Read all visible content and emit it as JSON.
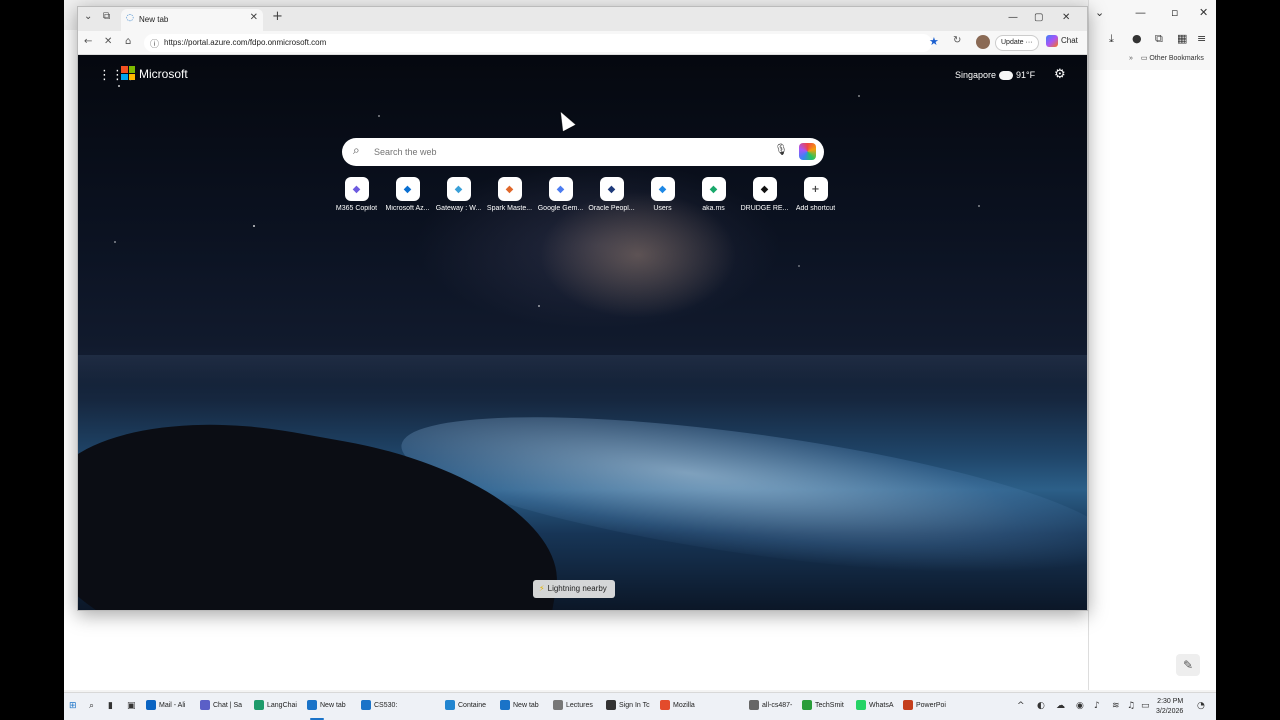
{
  "browser": {
    "tab_title": "New tab",
    "url": "https://portal.azure.com/fdpo.onmicrosoft.com",
    "update_label": "Update",
    "chat_label": "Chat"
  },
  "background_browser": {
    "bookmarks_label": "Other Bookmarks"
  },
  "new_tab_page": {
    "brand": "Microsoft",
    "weather_city": "Singapore",
    "weather_temp": "91°F",
    "search_placeholder": "Search the web",
    "shortcuts": [
      {
        "label": "M365 Copilot",
        "icon": "copilot-icon",
        "color": "#6d5be0"
      },
      {
        "label": "Microsoft Az...",
        "icon": "azure-icon",
        "color": "#0a6fd1"
      },
      {
        "label": "Gateway : W...",
        "icon": "gateway-icon",
        "color": "#3aa0d8"
      },
      {
        "label": "Spark Maste...",
        "icon": "spark-icon",
        "color": "#e0672a"
      },
      {
        "label": "Google Gem...",
        "icon": "gemini-icon",
        "color": "#4c7cf0"
      },
      {
        "label": "Oracle Peopl...",
        "icon": "oracle-icon",
        "color": "#1e3a7a"
      },
      {
        "label": "Users",
        "icon": "users-icon",
        "color": "#1e88e5"
      },
      {
        "label": "aka.ms",
        "icon": "akams-icon",
        "color": "#19a86b"
      },
      {
        "label": "DRUDGE RE...",
        "icon": "drudge-icon",
        "color": "#111111"
      },
      {
        "label": "Add shortcut",
        "icon": "plus-icon",
        "color": "#444444"
      }
    ],
    "notification": "Lightning nearby"
  },
  "taskbar": {
    "items": [
      {
        "label": "Mail - Ali",
        "color": "#0a64c2"
      },
      {
        "label": "Chat | Sa",
        "color": "#5b5fc7"
      },
      {
        "label": "LangChai",
        "color": "#1e9b6b"
      },
      {
        "label": "New tab",
        "color": "#1a73c8"
      },
      {
        "label": "CS530:",
        "color": "#1a73c8"
      },
      {
        "label": "Containe",
        "color": "#2185d0"
      },
      {
        "label": "New tab",
        "color": "#1a73c8"
      },
      {
        "label": "Lectures",
        "color": "#777777"
      },
      {
        "label": "Sign In Tc",
        "color": "#333333"
      },
      {
        "label": "Mozilla",
        "color": "#e34b2b"
      },
      {
        "label": "all-cs487-",
        "color": "#666666"
      },
      {
        "label": "TechSmit",
        "color": "#2a9d3a"
      },
      {
        "label": "WhatsA",
        "color": "#25d366"
      },
      {
        "label": "PowerPoi",
        "color": "#c43e1c"
      }
    ],
    "time": "2:30 PM",
    "date": "3/2/2026"
  }
}
